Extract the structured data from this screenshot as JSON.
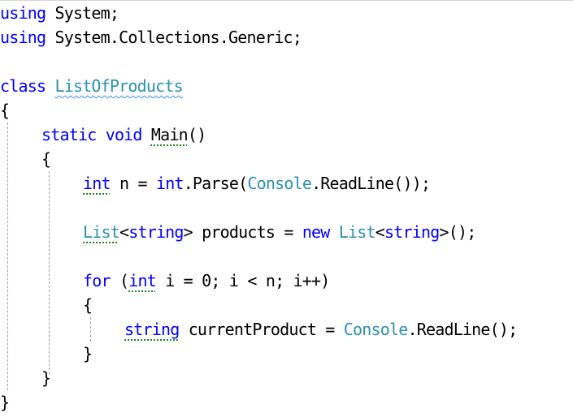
{
  "editor": {
    "lines": {
      "l1": {
        "kw": "using",
        "rest": " System;"
      },
      "l2": {
        "kw": "using",
        "rest": " System.Collections.Generic;"
      },
      "l4": {
        "kw": "class",
        "sp": " ",
        "name": "ListOfProducts"
      },
      "l5": {
        "brace": "{"
      },
      "l6": {
        "kw1": "static",
        "sp1": " ",
        "kw2": "void",
        "sp2": " ",
        "name": "Main",
        "rest": "()"
      },
      "l7": {
        "brace": "{"
      },
      "l8": {
        "kw1": "int",
        "mid": " n = ",
        "kw2": "int",
        "mid2": ".Parse(",
        "type": "Console",
        "rest": ".ReadLine());"
      },
      "l10": {
        "t1": "List",
        "p1": "<",
        "kw1": "string",
        "p2": "> products = ",
        "kw2": "new",
        "sp": " ",
        "t2": "List",
        "p3": "<",
        "kw3": "string",
        "p4": ">();"
      },
      "l12": {
        "kw1": "for",
        "mid": " (",
        "kw2": "int",
        "rest": " i = 0; i < n; i++)"
      },
      "l13": {
        "brace": "{"
      },
      "l14": {
        "kw": "string",
        "mid": " currentProduct = ",
        "type": "Console",
        "rest": ".ReadLine();"
      },
      "l15": {
        "brace": "}"
      },
      "l16": {
        "brace": "}"
      },
      "l17": {
        "brace": "}"
      }
    },
    "colors": {
      "keyword": "#0000ff",
      "type": "#2b91af",
      "text": "#000000",
      "squiggle": "#3a8fe8",
      "suggestion_dots": "#1e8a1e",
      "indent_guide": "#a0a0a0"
    }
  }
}
